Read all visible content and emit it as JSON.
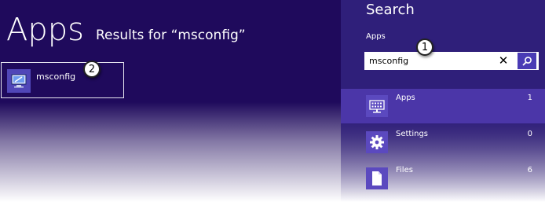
{
  "left": {
    "title": "Apps",
    "results_for": "Results for “msconfig”",
    "result": {
      "label": "msconfig",
      "icon": "system-config-monitor-icon"
    },
    "callout": "2"
  },
  "pane": {
    "heading": "Search",
    "scope_label": "Apps",
    "search": {
      "value": "msconfig",
      "clear_glyph": "✕"
    },
    "callout": "1",
    "filters": [
      {
        "label": "Apps",
        "count": "1",
        "icon": "apps-keyboard-icon",
        "selected": true
      },
      {
        "label": "Settings",
        "count": "0",
        "icon": "settings-gear-icon",
        "selected": false
      },
      {
        "label": "Files",
        "count": "6",
        "icon": "file-icon",
        "selected": false
      }
    ]
  },
  "colors": {
    "background": "#1f0a5c",
    "pane": "#2f1f7a",
    "selected_filter": "#4b36a8",
    "accent": "#4a3bb5"
  }
}
